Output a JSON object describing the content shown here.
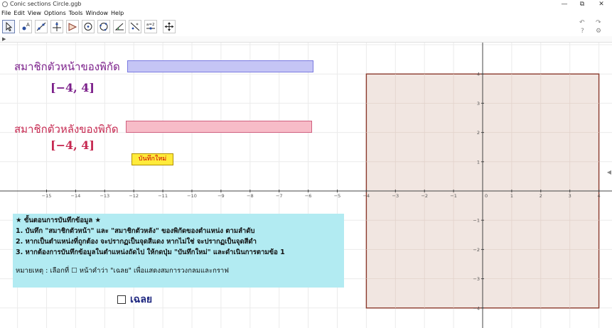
{
  "window": {
    "title": "Conic sections Circle.ggb",
    "controls": {
      "minimize": "—",
      "restore": "⧉",
      "close": "✕"
    }
  },
  "menu": [
    "File",
    "Edit",
    "View",
    "Options",
    "Tools",
    "Window",
    "Help"
  ],
  "toolbar": {
    "tools": [
      "move-tool",
      "point-tool",
      "line-tool",
      "perpendicular-tool",
      "polygon-tool",
      "circle-tool",
      "circle-three-points-tool",
      "angle-tool",
      "reflect-tool",
      "slider-tool",
      "move-view-tool"
    ],
    "slider_tool_label": "a=2",
    "undo": "↶",
    "redo": "↷",
    "help": "?",
    "settings": "⚙"
  },
  "labels": {
    "front_member": "สมาชิกตัวหน้าของพิกัด",
    "front_interval": "[−4, 4]",
    "back_member": "สมาชิกตัวหลังของพิกัด",
    "back_interval": "[−4, 4]",
    "reset_button": "บันทึกใหม่"
  },
  "instructions": {
    "heading": "★ ขั้นตอนการบันทึกข้อมูล ★",
    "step1": "1. บันทึก \"สมาชิกตัวหน้า\" และ \"สมาชิกตัวหลัง\" ของพิกัดของตำแหน่ง ตามลำดับ",
    "step2": "2. หากเป็นตำแหน่งที่ถูกต้อง จะปรากฏเป็นจุดสีแดง หากไม่ใช่ จะปรากฏเป็นจุดสีดำ",
    "step3": "3. หากต้องการบันทึกข้อมูลในตำแหน่งถัดไป ให้กดปุ่ม \"บันทึกใหม่\" และดำเนินการตามข้อ 1",
    "note": "หมายเหตุ : เลือกที่ ☐ หน้าคำว่า \"เฉลย\" เพื่อแสดงสมการวงกลมและกราฟ"
  },
  "answer_checkbox": {
    "label": "เฉลย",
    "checked": false
  },
  "graph": {
    "x_ticks": [
      -15,
      -14,
      -13,
      -12,
      -11,
      -10,
      -9,
      -8,
      -7,
      -6,
      -5,
      -4,
      -3,
      -2,
      -1,
      0,
      1,
      2,
      3,
      4
    ],
    "y_ticks": [
      -4,
      -3,
      -2,
      -1,
      1,
      2,
      3,
      4
    ],
    "square_region": {
      "x_range": [
        -4,
        4
      ],
      "y_range": [
        -4,
        4
      ]
    }
  },
  "colors": {
    "front_label": "#7b1f8a",
    "back_label": "#c62850",
    "front_slider": "#c5c5f5",
    "back_slider": "#f7bcc8",
    "square_fill": "#efe2dc",
    "square_stroke": "#8b3a2c",
    "instructions_bg": "#b2ebf2",
    "reset_bg": "#ffeb3b"
  }
}
